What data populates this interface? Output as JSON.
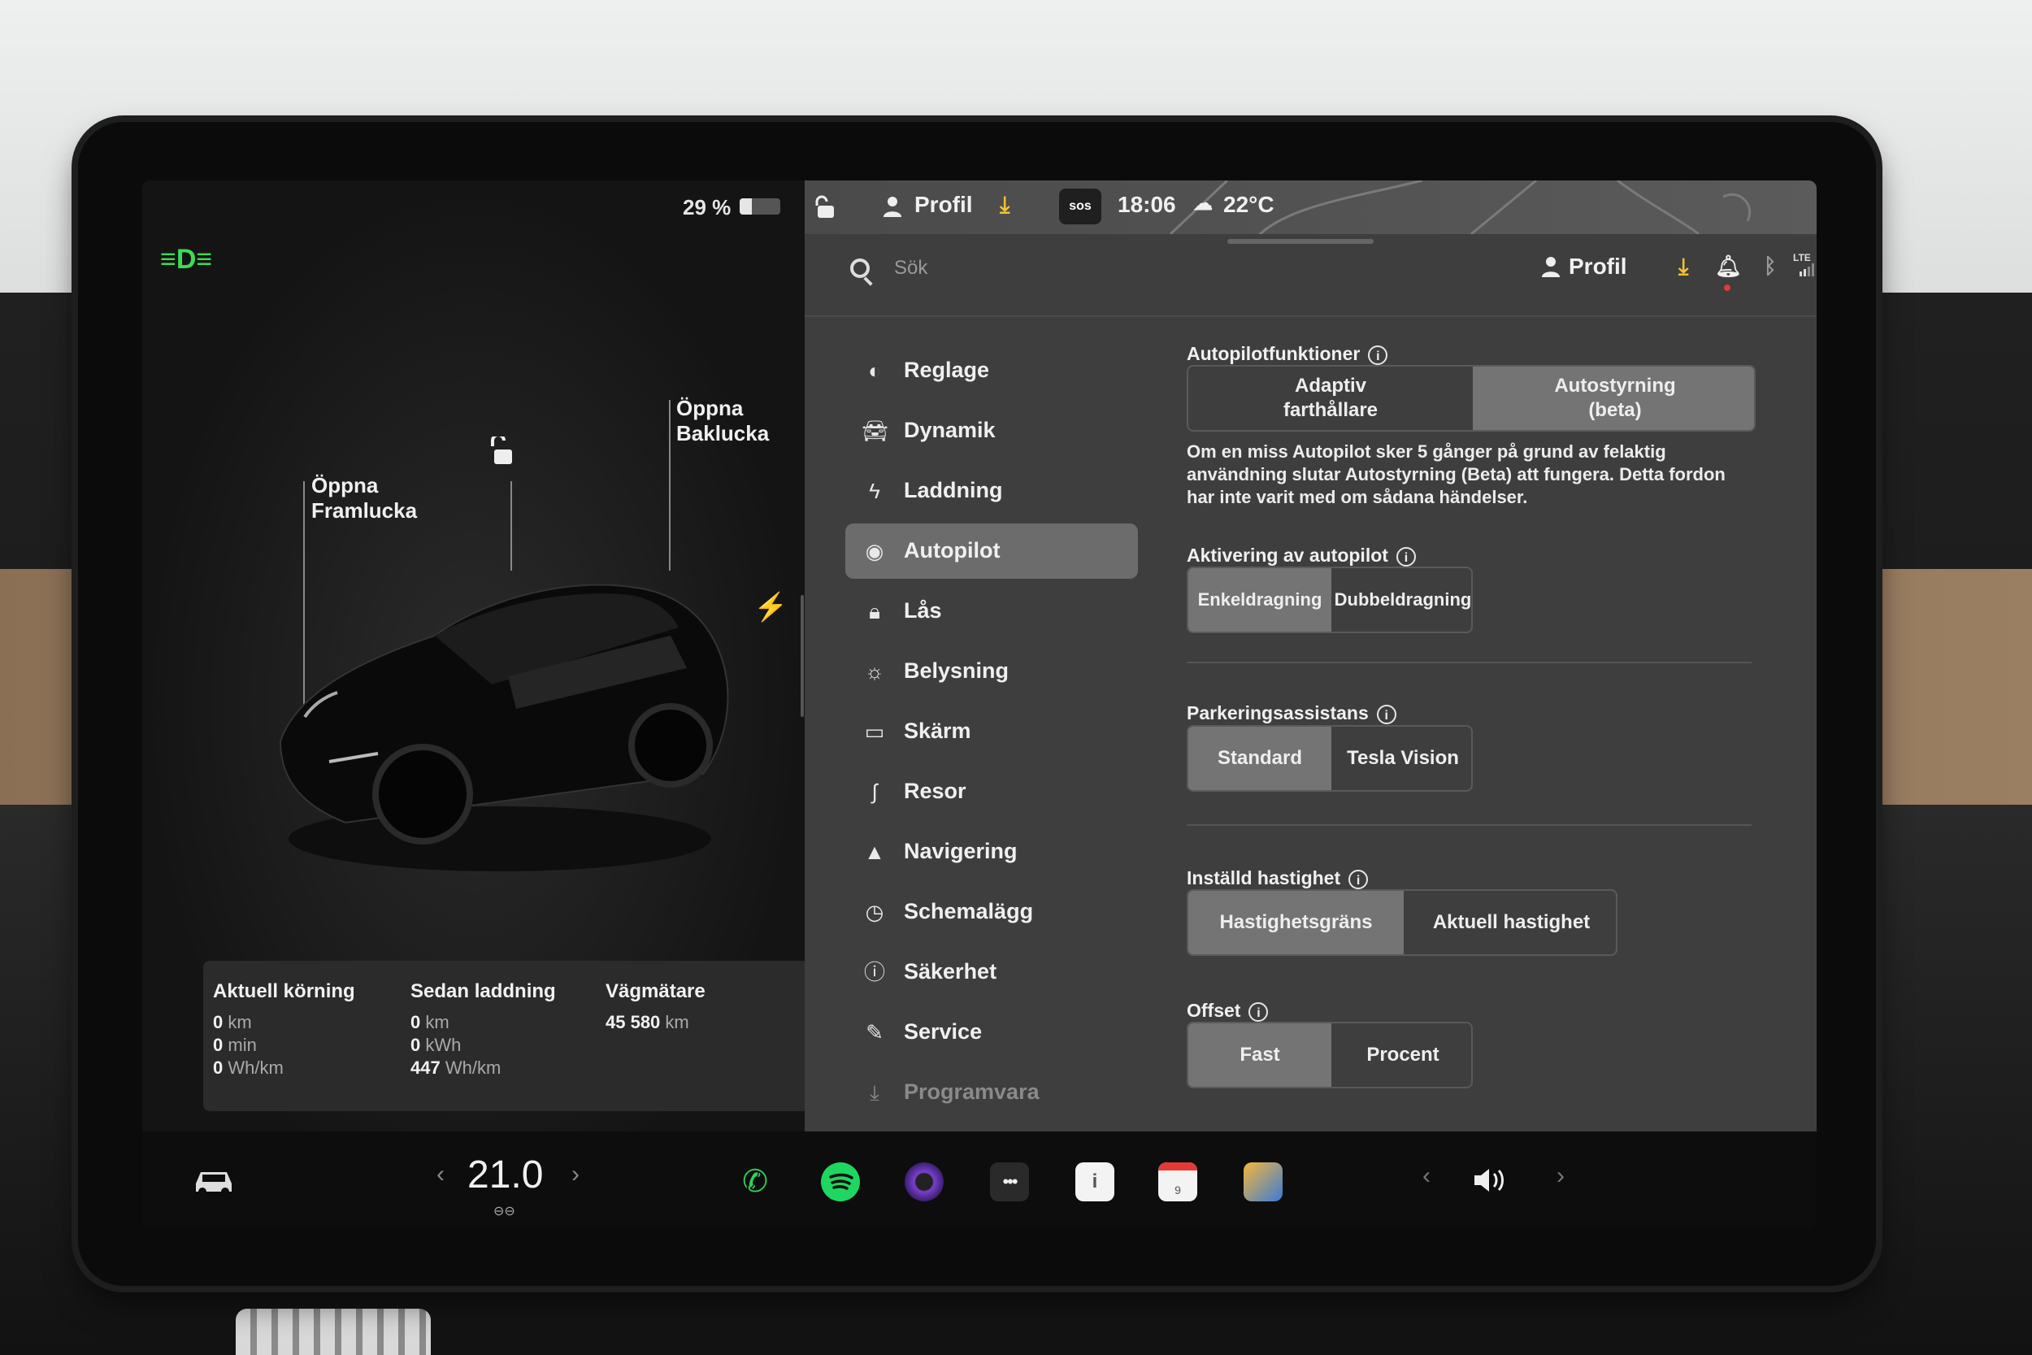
{
  "status": {
    "battery_percent_label": "29 %",
    "battery_fill_fraction": 0.29,
    "profile_label": "Profil",
    "sos_label": "sos",
    "time": "18:06",
    "temperature": "22°C"
  },
  "car_view": {
    "frunk_label": "Öppna\nFramlucka",
    "trunk_label": "Öppna\nBaklucka"
  },
  "trip_stats": {
    "current": {
      "title": "Aktuell körning",
      "rows": [
        {
          "v": "0",
          "u": "km"
        },
        {
          "v": "0",
          "u": "min"
        },
        {
          "v": "0",
          "u": "Wh/km"
        }
      ]
    },
    "since_charge": {
      "title": "Sedan laddning",
      "rows": [
        {
          "v": "0",
          "u": "km"
        },
        {
          "v": "0",
          "u": "kWh"
        },
        {
          "v": "447",
          "u": "Wh/km"
        }
      ]
    },
    "odometer": {
      "title": "Vägmätare",
      "rows": [
        {
          "v": "45 580",
          "u": "km"
        }
      ]
    }
  },
  "search": {
    "placeholder": "Sök",
    "profile_label": "Profil",
    "lte_label": "LTE"
  },
  "menu": [
    {
      "label": "Reglage",
      "icon": "toggle-icon",
      "active": false
    },
    {
      "label": "Dynamik",
      "icon": "car-icon",
      "active": false
    },
    {
      "label": "Laddning",
      "icon": "bolt-icon",
      "active": false
    },
    {
      "label": "Autopilot",
      "icon": "steering-wheel-icon",
      "active": true
    },
    {
      "label": "Lås",
      "icon": "lock-icon",
      "active": false
    },
    {
      "label": "Belysning",
      "icon": "light-icon",
      "active": false
    },
    {
      "label": "Skärm",
      "icon": "display-icon",
      "active": false
    },
    {
      "label": "Resor",
      "icon": "trips-icon",
      "active": false
    },
    {
      "label": "Navigering",
      "icon": "navigation-icon",
      "active": false
    },
    {
      "label": "Schemalägg",
      "icon": "schedule-icon",
      "active": false
    },
    {
      "label": "Säkerhet",
      "icon": "safety-icon",
      "active": false
    },
    {
      "label": "Service",
      "icon": "wrench-icon",
      "active": false
    },
    {
      "label": "Programvara",
      "icon": "download-icon",
      "active": false
    }
  ],
  "autopilot": {
    "features_title": "Autopilotfunktioner",
    "features_options": [
      "Adaptiv\nfarthållare",
      "Autostyrning\n(beta)"
    ],
    "features_selected": 1,
    "features_desc": "Om en miss Autopilot sker 5 gånger på grund av felaktig användning slutar Autostyrning (Beta) att fungera. Detta fordon har inte varit med om sådana händelser.",
    "activation_title": "Aktivering av autopilot",
    "activation_options": [
      "Enkeldragning",
      "Dubbeldragning"
    ],
    "activation_selected": 0,
    "parking_title": "Parkeringsassistans",
    "parking_options": [
      "Standard",
      "Tesla Vision"
    ],
    "parking_selected": 0,
    "speed_title": "Inställd hastighet",
    "speed_options": [
      "Hastighetsgräns",
      "Aktuell hastighet"
    ],
    "speed_selected": 0,
    "offset_title": "Offset",
    "offset_options": [
      "Fast",
      "Procent"
    ],
    "offset_selected": 0
  },
  "bottom_bar": {
    "temperature_value": "21.0",
    "calendar_day": "9"
  },
  "colors": {
    "accent_green": "#3ddc55",
    "download_yellow": "#f2c230",
    "spotify_green": "#1ed760",
    "phone_green": "#2fd158"
  }
}
